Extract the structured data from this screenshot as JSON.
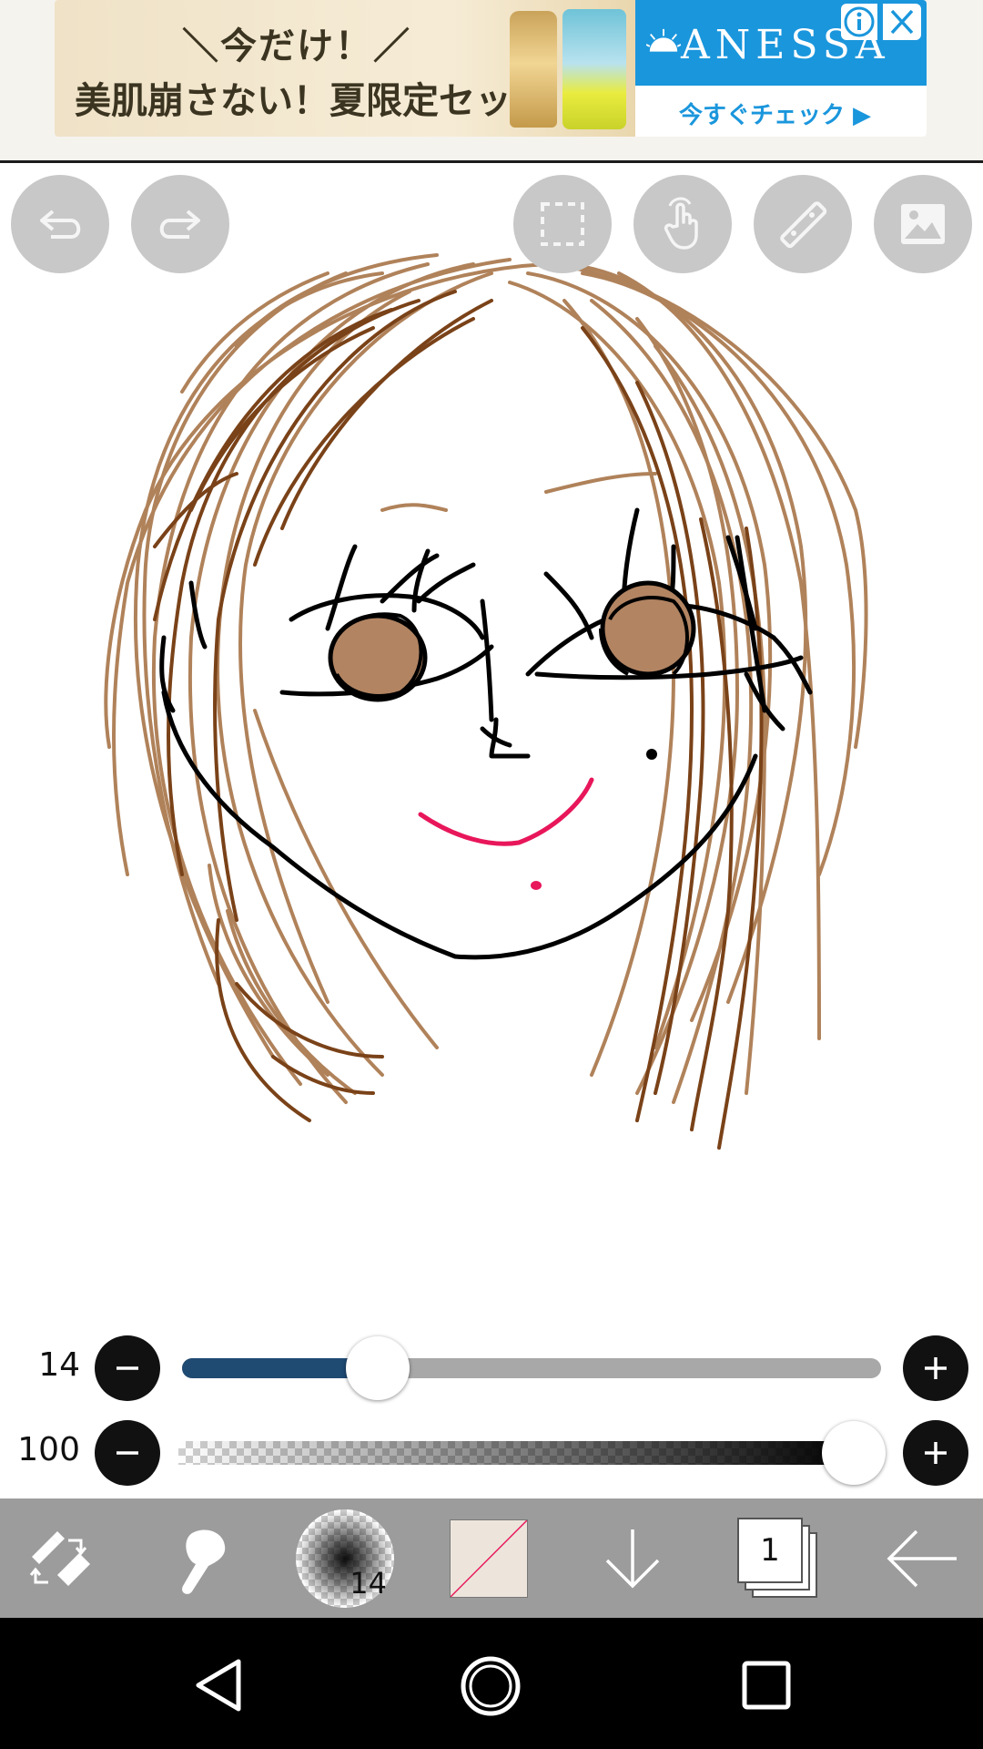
{
  "ad": {
    "line1": "＼今だけ！／",
    "line2": "美肌崩さない！夏限定セット",
    "brand": "ANESSA",
    "cta": "今すぐチェック ▶",
    "info_icon": "info-icon",
    "close_icon": "close-icon"
  },
  "top_tools": [
    {
      "name": "undo-button",
      "icon": "undo-icon"
    },
    {
      "name": "redo-button",
      "icon": "redo-icon"
    },
    {
      "name": "selection-button",
      "icon": "selection-icon"
    },
    {
      "name": "hand-tool-button",
      "icon": "hand-icon"
    },
    {
      "name": "ruler-button",
      "icon": "ruler-icon"
    },
    {
      "name": "image-button",
      "icon": "image-icon"
    }
  ],
  "brush_size": {
    "value_label": "14",
    "value": 14,
    "fraction": 0.28
  },
  "opacity": {
    "value_label": "100",
    "value": 100,
    "fraction": 1.0
  },
  "toolbar": {
    "brush_size_label": "14",
    "layer_count": "1",
    "items": [
      "tool-switch-icon",
      "fill-icon",
      "brush-preview",
      "color-swatch",
      "download-icon",
      "layers-icon",
      "back-arrow-icon"
    ]
  },
  "colors": {
    "toolbar_bg": "#9c9c9c",
    "slider_fill": "#1f4a72",
    "color_swatch": "#ede5dc",
    "hair_light": "#b0825a",
    "hair_dark": "#7a4218",
    "lips": "#e8165a",
    "iris": "#b28462"
  },
  "navbar": {
    "back_icon": "back-triangle-icon",
    "home_icon": "home-circle-icon",
    "recents_icon": "recents-square-icon"
  }
}
